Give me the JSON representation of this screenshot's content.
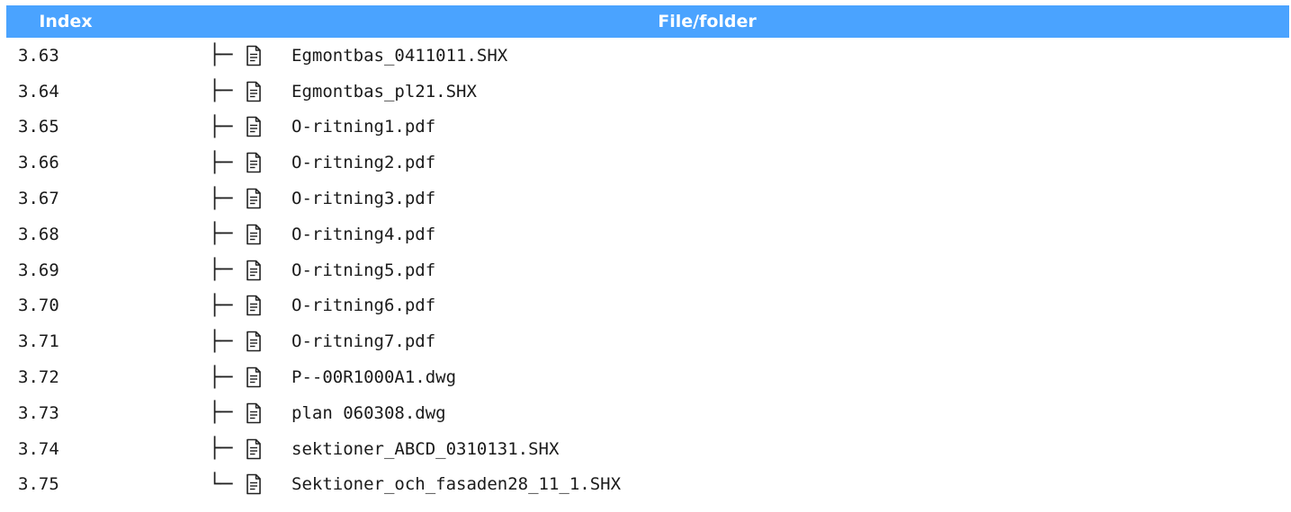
{
  "header": {
    "index_label": "Index",
    "file_label": "File/folder"
  },
  "colors": {
    "header_bg": "#4aa3ff",
    "header_text": "#ffffff"
  },
  "rows": [
    {
      "index": "3.63",
      "branch": "├─",
      "icon": "file-icon",
      "name": "Egmontbas_0411011.SHX"
    },
    {
      "index": "3.64",
      "branch": "├─",
      "icon": "file-icon",
      "name": "Egmontbas_pl21.SHX"
    },
    {
      "index": "3.65",
      "branch": "├─",
      "icon": "file-icon",
      "name": "O-ritning1.pdf"
    },
    {
      "index": "3.66",
      "branch": "├─",
      "icon": "file-icon",
      "name": "O-ritning2.pdf"
    },
    {
      "index": "3.67",
      "branch": "├─",
      "icon": "file-icon",
      "name": "O-ritning3.pdf"
    },
    {
      "index": "3.68",
      "branch": "├─",
      "icon": "file-icon",
      "name": "O-ritning4.pdf"
    },
    {
      "index": "3.69",
      "branch": "├─",
      "icon": "file-icon",
      "name": "O-ritning5.pdf"
    },
    {
      "index": "3.70",
      "branch": "├─",
      "icon": "file-icon",
      "name": "O-ritning6.pdf"
    },
    {
      "index": "3.71",
      "branch": "├─",
      "icon": "file-icon",
      "name": "O-ritning7.pdf"
    },
    {
      "index": "3.72",
      "branch": "├─",
      "icon": "file-icon",
      "name": "P--00R1000A1.dwg"
    },
    {
      "index": "3.73",
      "branch": "├─",
      "icon": "file-icon",
      "name": "plan 060308.dwg"
    },
    {
      "index": "3.74",
      "branch": "├─",
      "icon": "file-icon",
      "name": "sektioner_ABCD_0310131.SHX"
    },
    {
      "index": "3.75",
      "branch": "└─",
      "icon": "file-icon",
      "name": "Sektioner_och_fasaden28_11_1.SHX"
    }
  ]
}
